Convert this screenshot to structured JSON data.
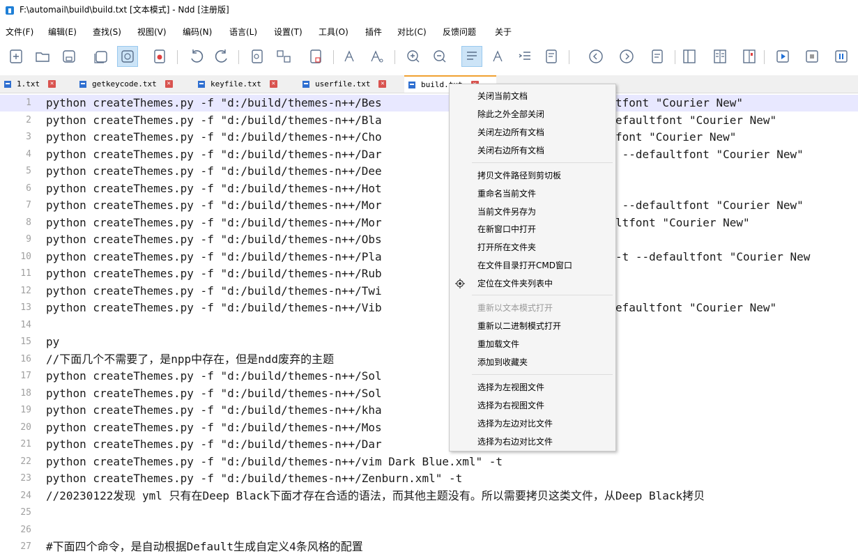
{
  "window": {
    "title": "F:\\automail\\build\\build.txt [文本模式] - Ndd [注册版]"
  },
  "menubar": [
    "文件(F)",
    "编辑(E)",
    "查找(S)",
    "视图(V)",
    "编码(N)",
    "语言(L)",
    "设置(T)",
    "工具(O)",
    "插件",
    "对比(C)",
    "反馈问题",
    "关于"
  ],
  "toolbar": {
    "icons": [
      "new-file-icon",
      "open-folder-icon",
      "save-icon",
      "save-all-icon",
      "auto-save-icon",
      "close-file-icon",
      "undo-icon",
      "redo-icon",
      "find-icon",
      "compare-icon",
      "replace-icon",
      "text-bigger-icon",
      "text-smaller-icon",
      "zoom-in-icon",
      "zoom-out-icon",
      "word-wrap-icon",
      "show-all-chars-icon",
      "indent-guide-icon",
      "bookmark-icon",
      "previous-icon",
      "next-icon",
      "format-icon",
      "split-view-icon",
      "column-view-icon",
      "binary-icon",
      "play-macro-icon",
      "stop-icon",
      "pause-icon"
    ]
  },
  "tabs": [
    {
      "label": "1.txt",
      "active": false
    },
    {
      "label": "getkeycode.txt",
      "active": false
    },
    {
      "label": "keyfile.txt",
      "active": false
    },
    {
      "label": "userfile.txt",
      "active": false
    },
    {
      "label": "build.txt",
      "active": true
    }
  ],
  "editor": {
    "lines": [
      {
        "n": "1",
        "left": "python createThemes.py -f \"d:/build/themes-n++/Bes",
        "right": "tfont \"Courier New\""
      },
      {
        "n": "2",
        "left": "python createThemes.py -f \"d:/build/themes-n++/Bla",
        "right": "efaultfont \"Courier New\""
      },
      {
        "n": "3",
        "left": "python createThemes.py -f \"d:/build/themes-n++/Cho",
        "right": "font \"Courier New\""
      },
      {
        "n": "4",
        "left": "python createThemes.py -f \"d:/build/themes-n++/Dar",
        "right": " --defaultfont \"Courier New\""
      },
      {
        "n": "5",
        "left": "python createThemes.py -f \"d:/build/themes-n++/Dee",
        "right": ""
      },
      {
        "n": "6",
        "left": "python createThemes.py -f \"d:/build/themes-n++/Hot",
        "right": ""
      },
      {
        "n": "7",
        "left": "python createThemes.py -f \"d:/build/themes-n++/Mor",
        "right": " --defaultfont \"Courier New\""
      },
      {
        "n": "8",
        "left": "python createThemes.py -f \"d:/build/themes-n++/Mor",
        "right": "ltfont \"Courier New\""
      },
      {
        "n": "9",
        "left": "python createThemes.py -f \"d:/build/themes-n++/Obs",
        "right": ""
      },
      {
        "n": "10",
        "left": "python createThemes.py -f \"d:/build/themes-n++/Pla",
        "right": "-t --defaultfont \"Courier New"
      },
      {
        "n": "11",
        "left": "python createThemes.py -f \"d:/build/themes-n++/Rub",
        "right": ""
      },
      {
        "n": "12",
        "left": "python createThemes.py -f \"d:/build/themes-n++/Twi",
        "right": ""
      },
      {
        "n": "13",
        "left": "python createThemes.py -f \"d:/build/themes-n++/Vib",
        "right": "efaultfont \"Courier New\""
      },
      {
        "n": "14",
        "left": "",
        "right": ""
      },
      {
        "n": "15",
        "left": "py",
        "right": ""
      },
      {
        "n": "16",
        "left": "//下面几个不需要了，是npp中存在，但是ndd废弃的主题",
        "right": ""
      },
      {
        "n": "17",
        "left": "python createThemes.py -f \"d:/build/themes-n++/Sol",
        "right": ""
      },
      {
        "n": "18",
        "left": "python createThemes.py -f \"d:/build/themes-n++/Sol",
        "right": ""
      },
      {
        "n": "19",
        "left": "python createThemes.py -f \"d:/build/themes-n++/kha",
        "right": ""
      },
      {
        "n": "20",
        "left": "python createThemes.py -f \"d:/build/themes-n++/Mos",
        "right": ""
      },
      {
        "n": "21",
        "left": "python createThemes.py -f \"d:/build/themes-n++/Dar",
        "right": ""
      },
      {
        "n": "22",
        "left": "python createThemes.py -f \"d:/build/themes-n++/vim Dark Blue.xml\" -t",
        "right": ""
      },
      {
        "n": "23",
        "left": "python createThemes.py -f \"d:/build/themes-n++/Zenburn.xml\" -t",
        "right": ""
      },
      {
        "n": "24",
        "left": "//20230122发现 yml 只有在Deep Black下面才存在合适的语法，而其他主题没有。所以需要拷贝这类文件，从Deep Black拷贝",
        "right": ""
      },
      {
        "n": "25",
        "left": "",
        "right": ""
      },
      {
        "n": "26",
        "left": "",
        "right": ""
      },
      {
        "n": "27",
        "left": "#下面四个命令，是自动根据Default生成自定义4条风格的配置",
        "right": ""
      }
    ]
  },
  "context_menu": {
    "items": [
      {
        "label": "关闭当前文档",
        "disabled": false
      },
      {
        "label": "除此之外全部关闭",
        "disabled": false
      },
      {
        "label": "关闭左边所有文档",
        "disabled": false
      },
      {
        "label": "关闭右边所有文档",
        "disabled": false
      },
      {
        "label": "拷贝文件路径到剪切板",
        "disabled": false
      },
      {
        "label": "重命名当前文件",
        "disabled": false
      },
      {
        "label": "当前文件另存为",
        "disabled": false
      },
      {
        "label": "在新窗口中打开",
        "disabled": false
      },
      {
        "label": "打开所在文件夹",
        "disabled": false
      },
      {
        "label": "在文件目录打开CMD窗口",
        "disabled": false
      },
      {
        "label": "定位在文件夹列表中",
        "disabled": false
      },
      {
        "label": "重新以文本模式打开",
        "disabled": true
      },
      {
        "label": "重新以二进制模式打开",
        "disabled": false
      },
      {
        "label": "重加载文件",
        "disabled": false
      },
      {
        "label": "添加到收藏夹",
        "disabled": false
      },
      {
        "label": "选择为左视图文件",
        "disabled": false
      },
      {
        "label": "选择为右视图文件",
        "disabled": false
      },
      {
        "label": "选择为左边对比文件",
        "disabled": false
      },
      {
        "label": "选择为右边对比文件",
        "disabled": false
      }
    ]
  }
}
